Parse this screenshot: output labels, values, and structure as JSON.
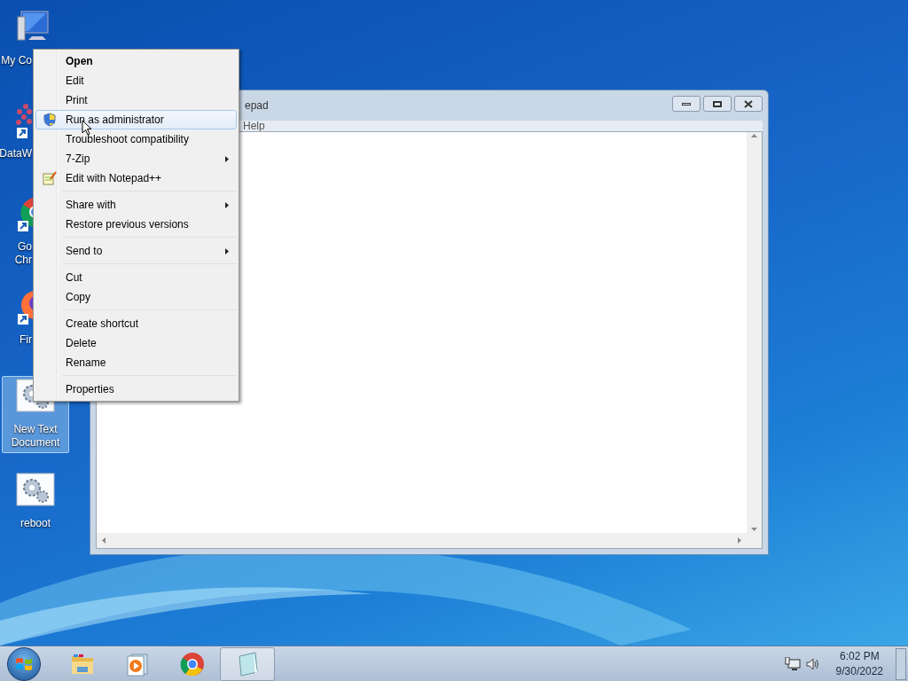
{
  "desktop_icons": [
    {
      "kind": "computer",
      "lines": [
        "My Co"
      ],
      "selected": false
    },
    {
      "kind": "shortcut-dots",
      "lines": [
        "DataW"
      ],
      "selected": false
    },
    {
      "kind": "chrome",
      "lines": [
        "Go",
        "Chr"
      ],
      "selected": false
    },
    {
      "kind": "firefox",
      "lines": [
        "Fir"
      ],
      "selected": false
    },
    {
      "kind": "gear",
      "lines": [
        "New Text",
        "Document"
      ],
      "selected": true
    },
    {
      "kind": "gear",
      "lines": [
        "reboot"
      ],
      "selected": false
    }
  ],
  "window": {
    "title": "epad",
    "menu": [
      "Help"
    ]
  },
  "context_menu": {
    "groups": [
      [
        {
          "label": "Open",
          "kind": "default",
          "selected": false
        },
        {
          "label": "Edit",
          "kind": "item",
          "selected": false
        },
        {
          "label": "Print",
          "kind": "item",
          "selected": false
        },
        {
          "label": "Run as administrator",
          "kind": "shield",
          "selected": true
        },
        {
          "label": "Troubleshoot compatibility",
          "kind": "item",
          "selected": false
        },
        {
          "label": "7-Zip",
          "kind": "submenu",
          "selected": false
        },
        {
          "label": "Edit with Notepad++",
          "kind": "notepad",
          "selected": false
        }
      ],
      [
        {
          "label": "Share with",
          "kind": "submenu",
          "selected": false
        },
        {
          "label": "Restore previous versions",
          "kind": "item",
          "selected": false
        }
      ],
      [
        {
          "label": "Send to",
          "kind": "submenu",
          "selected": false
        }
      ],
      [
        {
          "label": "Cut",
          "kind": "item",
          "selected": false
        },
        {
          "label": "Copy",
          "kind": "item",
          "selected": false
        }
      ],
      [
        {
          "label": "Create shortcut",
          "kind": "item",
          "selected": false
        },
        {
          "label": "Delete",
          "kind": "item",
          "selected": false
        },
        {
          "label": "Rename",
          "kind": "item",
          "selected": false
        }
      ],
      [
        {
          "label": "Properties",
          "kind": "item",
          "selected": false
        }
      ]
    ]
  },
  "taskbar": {
    "items": [
      {
        "kind": "explorer",
        "active": false
      },
      {
        "kind": "media",
        "active": false
      },
      {
        "kind": "chrome",
        "active": false
      },
      {
        "kind": "notepad",
        "active": true
      }
    ],
    "clock": {
      "time": "6:02 PM",
      "date": "9/30/2022"
    }
  }
}
